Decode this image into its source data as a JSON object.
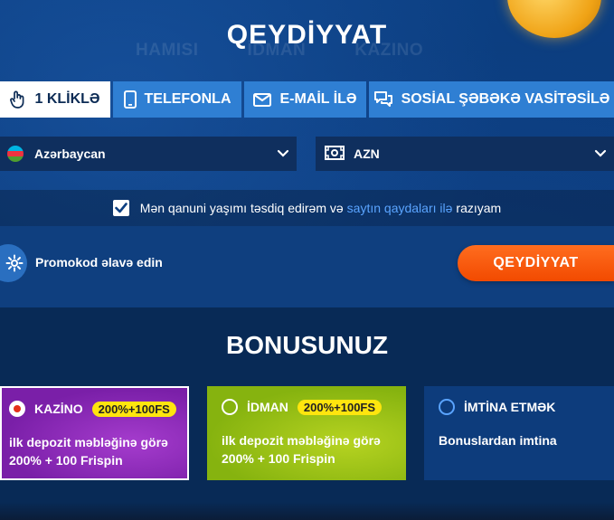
{
  "page": {
    "title": "QEYDİYYAT"
  },
  "background_tabs": [
    "HAMISI",
    "İDMAN",
    "KAZINO"
  ],
  "tabs": [
    {
      "label": "1 KLİKLƏ",
      "icon": "hand-icon",
      "active": true
    },
    {
      "label": "TELEFONLA",
      "icon": "phone-icon",
      "active": false
    },
    {
      "label": "E-MAİL İLƏ",
      "icon": "envelope-icon",
      "active": false
    },
    {
      "label": "SOSİAL ŞƏBƏKƏ VASİTƏSİLƏ",
      "icon": "chat-icon",
      "active": false
    }
  ],
  "country": {
    "value": "Azərbaycan",
    "icon": "azerbaijan-flag-icon"
  },
  "currency": {
    "value": "AZN",
    "icon": "banknote-icon"
  },
  "agree": {
    "prefix": "Mən qanuni yaşımı təsdiq edirəm və",
    "link": "saytın qaydaları ilə",
    "suffix": "razıyam",
    "checked": true
  },
  "promo": {
    "label": "Promokod əlavə edin",
    "icon": "gear-icon"
  },
  "register_button": "QEYDİYYAT",
  "bonus": {
    "title": "BONUSUNUZ",
    "options": [
      {
        "name": "KAZİNO",
        "badge": "200%+100FS",
        "line1": "ilk depozit məbləğinə görə",
        "line2": "200% + 100 Frispin",
        "selected": true
      },
      {
        "name": "İDMAN",
        "badge": "200%+100FS",
        "line1": "ilk depozit məbləğinə görə",
        "line2": "200% + 100 Frispin",
        "selected": false
      },
      {
        "name": "İMTİNA ETMƏK",
        "badge": "",
        "line1": "Bonuslardan imtina",
        "line2": "",
        "selected": false
      }
    ]
  },
  "colors": {
    "accent": "#2f7fd3",
    "button": "#f24a00",
    "badge": "#ffe50e",
    "kazino": "#7a1fa8",
    "idman": "#86b30f"
  }
}
